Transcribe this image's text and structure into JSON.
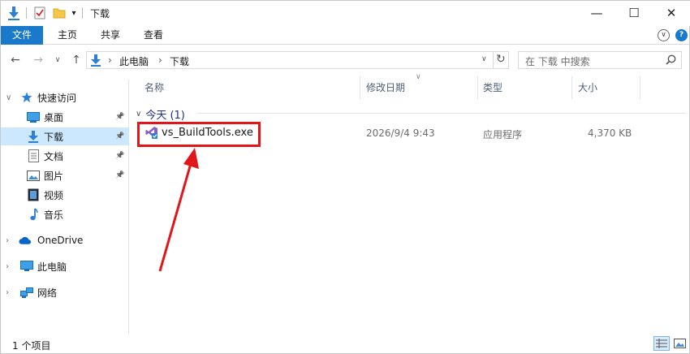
{
  "window": {
    "title": "下载",
    "minimize_symbol": "—",
    "maximize_symbol": "☐",
    "close_symbol": "✕",
    "dropdown_symbol": "▾"
  },
  "ribbon": {
    "tabs": [
      "文件",
      "主页",
      "共享",
      "查看"
    ],
    "expand_symbol": "∨",
    "help_symbol": "?"
  },
  "nav": {
    "back_symbol": "←",
    "forward_symbol": "→",
    "recent_symbol": "∨",
    "up_symbol": "↑",
    "refresh_symbol": "↻",
    "dropdown_symbol": "∨"
  },
  "address": {
    "crumbs": [
      "此电脑",
      "下载"
    ],
    "separator": "›"
  },
  "search": {
    "placeholder": "在 下载 中搜索"
  },
  "navpane": {
    "quick_access": "快速访问",
    "pinned": [
      "桌面",
      "下载",
      "文档",
      "图片"
    ],
    "others": [
      "视频",
      "音乐"
    ],
    "onedrive": "OneDrive",
    "this_pc": "此电脑",
    "network": "网络",
    "expanded_symbol": "∨",
    "collapsed_symbol": "›",
    "pin_symbol": "📌"
  },
  "columns": {
    "name": "名称",
    "date": "修改日期",
    "type": "类型",
    "size": "大小",
    "sort_symbol": "∨"
  },
  "group": {
    "label": "今天 (1)",
    "chevron": "∨"
  },
  "files": [
    {
      "name": "vs_BuildTools.exe",
      "date": "2026/9/4 9:43",
      "type": "应用程序",
      "size": "4,370 KB"
    }
  ],
  "status": {
    "items_text": "1 个项目"
  },
  "colors": {
    "accent": "#1979ca",
    "selection": "#cce8ff",
    "highlight": "#e0161a",
    "header_text": "#4c607a",
    "group_text": "#1e3287"
  }
}
